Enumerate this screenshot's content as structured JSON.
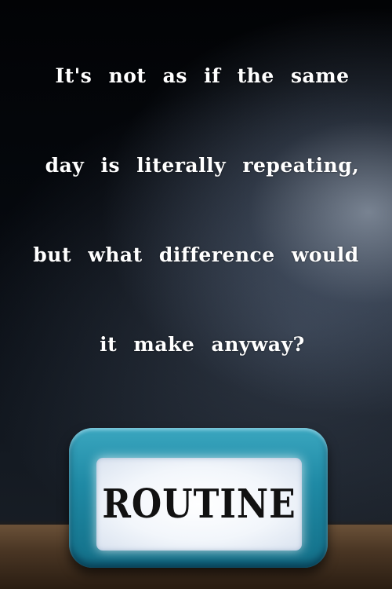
{
  "quote": {
    "line1": "It's not as if the same",
    "line2": "day is literally repeating,",
    "line3": "but what difference would",
    "line4": "it make anyway?"
  },
  "clock": {
    "label": "ROUTINE",
    "frame_color": "#1f8aa5",
    "face_color": "#ffffff"
  }
}
